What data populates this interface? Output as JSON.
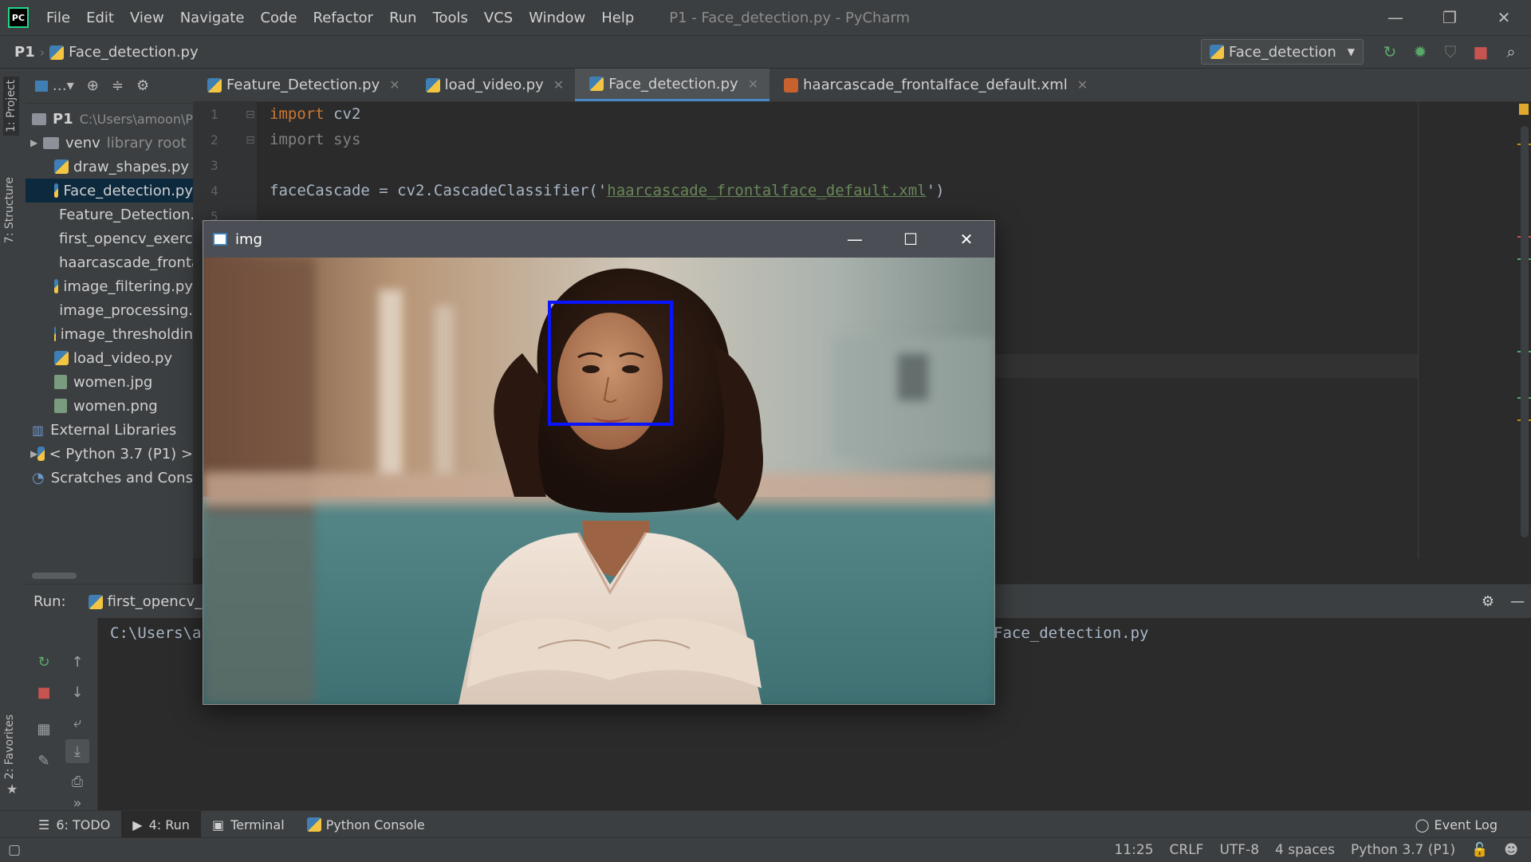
{
  "menubar": {
    "logo_text": "PC",
    "items": [
      "File",
      "Edit",
      "View",
      "Navigate",
      "Code",
      "Refactor",
      "Run",
      "Tools",
      "VCS",
      "Window",
      "Help"
    ],
    "window_title": "P1 - Face_detection.py - PyCharm"
  },
  "navbar": {
    "project": "P1",
    "file": "Face_detection.py",
    "run_config": "Face_detection"
  },
  "left_strip": {
    "project_tab": "1: Project",
    "structure_tab": "7: Structure",
    "favorites_tab": "2: Favorites"
  },
  "project_tree": {
    "root": "P1",
    "root_path": "C:\\Users\\amoon\\P",
    "venv": "venv",
    "venv_note": "library root",
    "files": [
      {
        "name": "draw_shapes.py",
        "type": "py"
      },
      {
        "name": "Face_detection.py",
        "type": "py"
      },
      {
        "name": "Feature_Detection.",
        "type": "py"
      },
      {
        "name": "first_opencv_exerci",
        "type": "py"
      },
      {
        "name": "haarcascade_fronta",
        "type": "xml"
      },
      {
        "name": "image_filtering.py",
        "type": "py"
      },
      {
        "name": "image_processing.",
        "type": "py"
      },
      {
        "name": "image_thresholdin",
        "type": "py"
      },
      {
        "name": "load_video.py",
        "type": "py"
      },
      {
        "name": "women.jpg",
        "type": "img"
      },
      {
        "name": "women.png",
        "type": "img"
      }
    ],
    "external_libraries": "External Libraries",
    "python_sdk": "< Python 3.7 (P1) >",
    "scratches": "Scratches and Console"
  },
  "editor_tabs": [
    {
      "label": "Feature_Detection.py",
      "type": "py",
      "active": false
    },
    {
      "label": "load_video.py",
      "type": "py",
      "active": false
    },
    {
      "label": "Face_detection.py",
      "type": "py",
      "active": true
    },
    {
      "label": "haarcascade_frontalface_default.xml",
      "type": "xml",
      "active": false
    }
  ],
  "code": {
    "line_numbers": [
      "1",
      "2",
      "3",
      "4",
      "5"
    ],
    "line1_kw": "import",
    "line1_rest": " cv2",
    "line2_kw": "import",
    "line2_rest": " sys",
    "line4_pre": "faceCascade = cv2.CascadeClassifier('",
    "line4_str": "haarcascade_frontalface_default.xml",
    "line4_post": "')"
  },
  "run_panel": {
    "label": "Run:",
    "config_tab": "first_opencv_ex",
    "console_prefix": "C:\\Users\\a",
    "console_suffix": "Face_detection.py"
  },
  "image_window": {
    "title": "img",
    "minimize": "—",
    "maximize": "☐",
    "close": "✕"
  },
  "tool_tabs": [
    {
      "label": "6: TODO",
      "active": false
    },
    {
      "label": "4: Run",
      "active": true
    },
    {
      "label": "Terminal",
      "active": false
    },
    {
      "label": "Python Console",
      "active": false
    }
  ],
  "event_log": "Event Log",
  "status": {
    "position": "11:25",
    "line_sep": "CRLF",
    "encoding": "UTF-8",
    "indent": "4 spaces",
    "interpreter": "Python 3.7 (P1)"
  },
  "colors": {
    "face_box": "#0a14ff",
    "keyword": "#cc7832",
    "string": "#6a8759"
  }
}
